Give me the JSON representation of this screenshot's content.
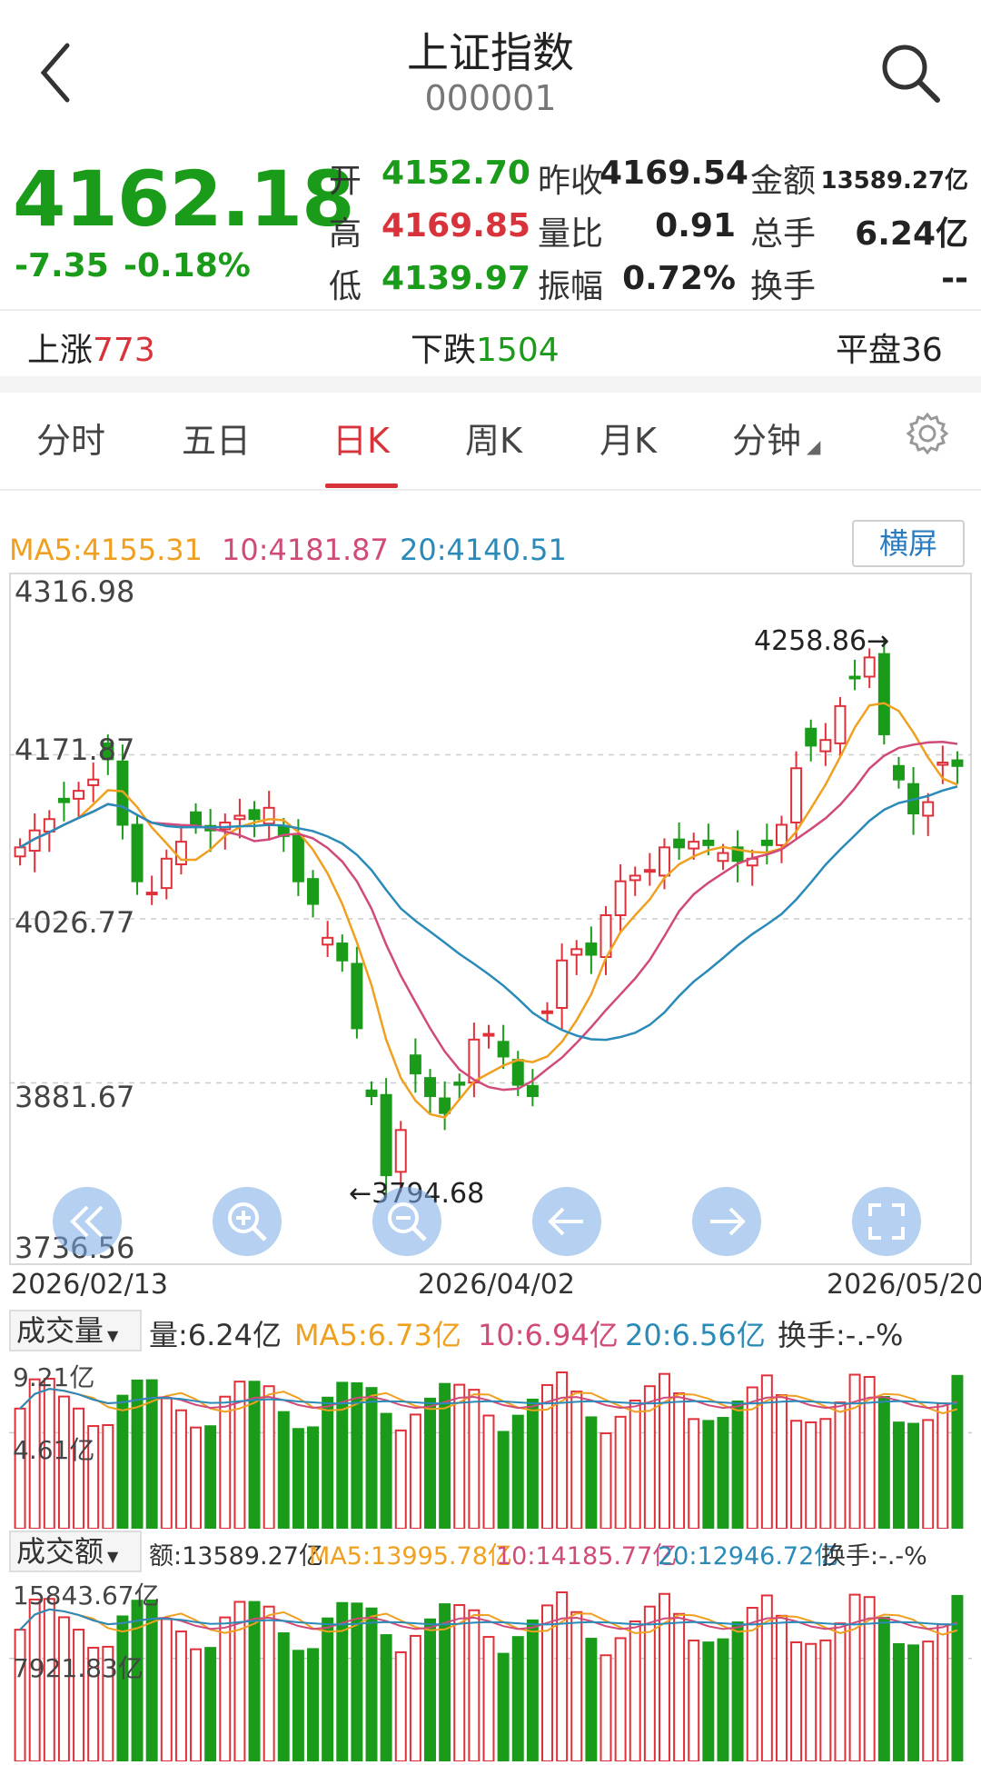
{
  "header": {
    "title": "上证指数",
    "code": "000001",
    "back_icon": "chevron-left-icon",
    "search_icon": "search-icon"
  },
  "quote": {
    "price": "4162.18",
    "change": "-7.35",
    "change_pct": "-0.18%",
    "open_label": "开",
    "open": "4152.70",
    "high_label": "高",
    "high": "4169.85",
    "low_label": "低",
    "low": "4139.97",
    "prev_close_label": "昨收",
    "prev_close": "4169.54",
    "vol_ratio_label": "量比",
    "vol_ratio": "0.91",
    "amplitude_label": "振幅",
    "amplitude": "0.72%",
    "amount_label": "金额",
    "amount": "13589.27亿",
    "total_hand_label": "总手",
    "total_hand": "6.24亿",
    "turnover_label": "换手",
    "turnover": "--"
  },
  "breadth": {
    "up_label": "上涨",
    "up": "773",
    "down_label": "下跌",
    "down": "1504",
    "flat_label": "平盘",
    "flat": "36"
  },
  "tabs": [
    "分时",
    "五日",
    "日K",
    "周K",
    "月K",
    "分钟"
  ],
  "active_tab": "日K",
  "ma": {
    "ma5": "MA5:4155.31",
    "ma10": "10:4181.87",
    "ma20": "20:4140.51"
  },
  "landscape_button": "横屏",
  "chart_data": {
    "type": "candlestick",
    "y_ticks": [
      "4316.98",
      "4171.87",
      "4026.77",
      "3881.67",
      "3736.56"
    ],
    "x_ticks": [
      "2026/02/13",
      "2026/04/02",
      "2026/05/20"
    ],
    "max_label": "4258.86",
    "min_label": "3794.68",
    "colors": {
      "up": "#e0303a",
      "down": "#1a9b1a",
      "ma5": "#f0a020",
      "ma10": "#d04a7a",
      "ma20": "#2a8ab8"
    }
  },
  "volume": {
    "selector": "成交量",
    "vol": "量:6.24亿",
    "ma5": "MA5:6.73亿",
    "ma10": "10:6.94亿",
    "ma20": "20:6.56亿",
    "turn": "换手:-.-%",
    "y_top": "9.21亿",
    "y_mid": "4.61亿"
  },
  "amount": {
    "selector": "成交额",
    "amt": "额:13589.27亿",
    "ma5": "MA5:13995.78亿",
    "ma10": "10:14185.77亿",
    "ma20": "20:12946.72亿",
    "turn": "换手:-.-%",
    "y_top": "15843.67亿",
    "y_mid": "7921.83亿"
  }
}
